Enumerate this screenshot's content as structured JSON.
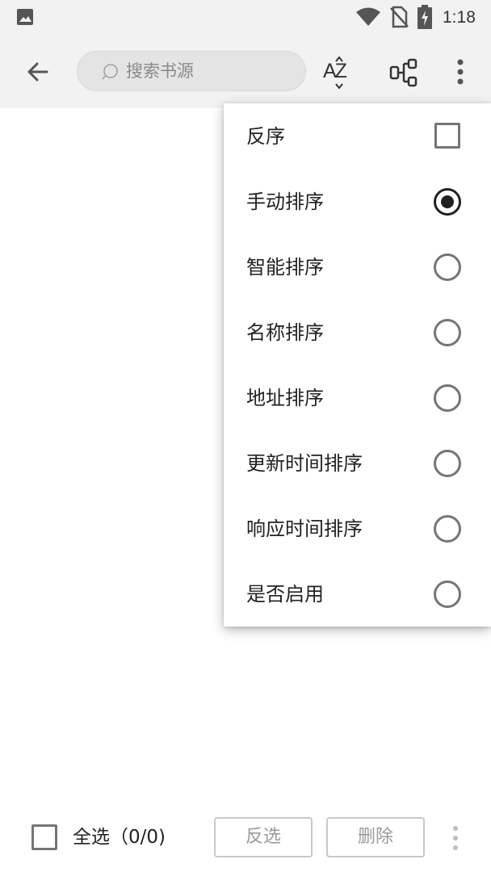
{
  "status_bar": {
    "time": "1:18",
    "icons": [
      "gallery-icon",
      "wifi-icon",
      "no-sim-icon",
      "battery-charging-icon"
    ]
  },
  "toolbar": {
    "back_icon": "arrow-left-icon",
    "search_placeholder": "搜索书源",
    "sort_icon_text": "AZ",
    "group_icon": "group-icon",
    "more_icon": "more-vert-icon"
  },
  "menu": {
    "items": [
      {
        "label": "反序",
        "control": "checkbox",
        "checked": false
      },
      {
        "label": "手动排序",
        "control": "radio",
        "checked": true
      },
      {
        "label": "智能排序",
        "control": "radio",
        "checked": false
      },
      {
        "label": "名称排序",
        "control": "radio",
        "checked": false
      },
      {
        "label": "地址排序",
        "control": "radio",
        "checked": false
      },
      {
        "label": "更新时间排序",
        "control": "radio",
        "checked": false
      },
      {
        "label": "响应时间排序",
        "control": "radio",
        "checked": false
      },
      {
        "label": "是否启用",
        "control": "radio",
        "checked": false
      }
    ]
  },
  "bottom_bar": {
    "select_all_label": "全选（0/0)",
    "invert_label": "反选",
    "delete_label": "删除",
    "more_icon": "more-vert-icon"
  },
  "colors": {
    "toolbar_bg": "#f2f2f2",
    "search_bg": "#e4e4e4",
    "icon": "#555555",
    "disabled_text": "#9a9a9a"
  }
}
